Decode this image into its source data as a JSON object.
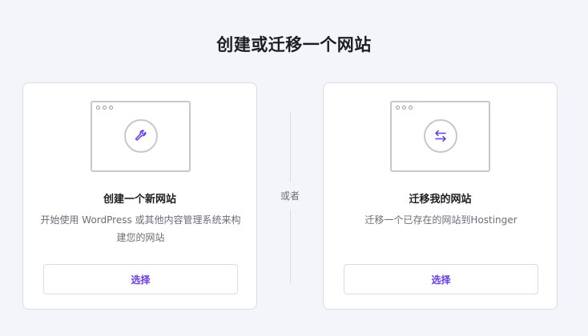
{
  "header": {
    "title": "创建或迁移一个网站"
  },
  "divider": {
    "label": "或者"
  },
  "cards": [
    {
      "icon": "wrench-icon",
      "title": "创建一个新网站",
      "description": "开始使用 WordPress 或其他内容管理系统来构建您的网站",
      "button_label": "选择"
    },
    {
      "icon": "transfer-arrows-icon",
      "title": "迁移我的网站",
      "description": "迁移一个已存在的网站到Hostinger",
      "button_label": "选择"
    }
  ],
  "colors": {
    "accent": "#673de6",
    "background": "#f4f4fb",
    "card_border": "#dadce0",
    "title_text": "#1d1e20",
    "muted_text": "#6d6d75"
  }
}
